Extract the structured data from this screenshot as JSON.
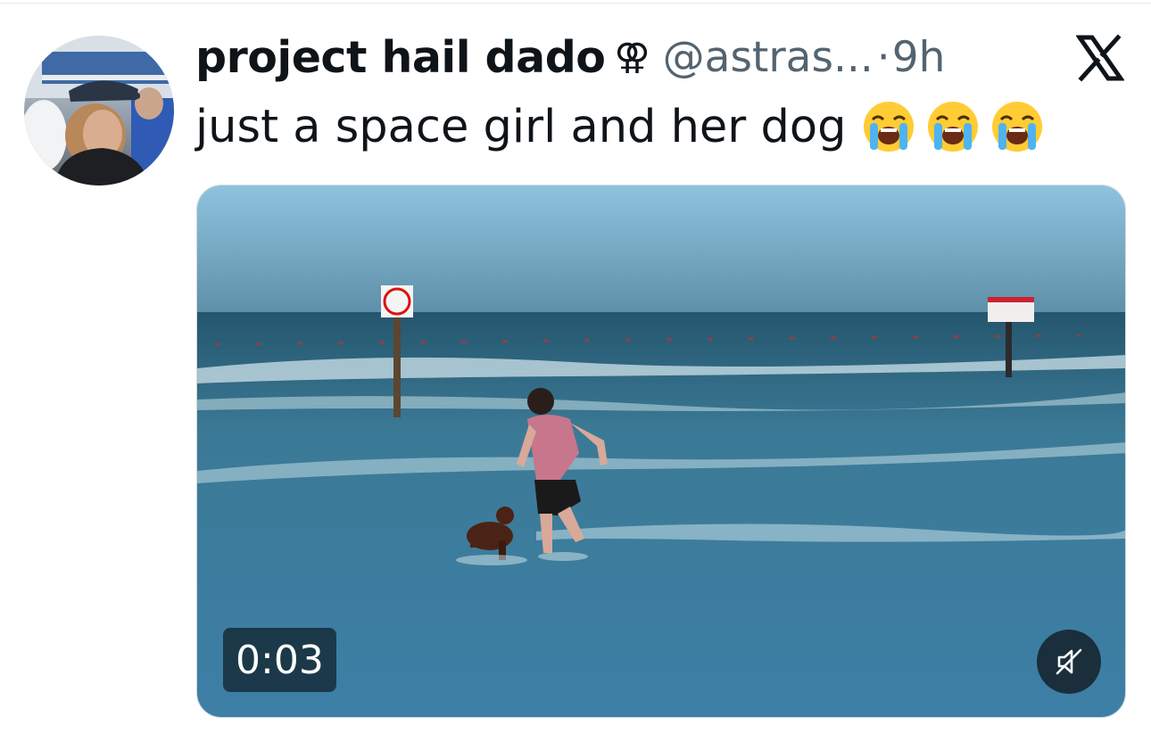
{
  "post": {
    "display_name": "project hail dado",
    "name_symbol": "⚢",
    "handle": "@astras...",
    "separator": "·",
    "time": "9h",
    "text": "just a space girl and her dog",
    "emojis": [
      "loudly-crying-face",
      "loudly-crying-face",
      "loudly-crying-face"
    ]
  },
  "header": {
    "logo_icon": "x-logo-icon"
  },
  "media": {
    "kind": "video",
    "duration": "0:03",
    "muted": true,
    "mute_icon": "volume-muted-icon"
  },
  "colors": {
    "text_primary": "#0f1419",
    "text_secondary": "#536471",
    "border": "#cfd9de"
  }
}
